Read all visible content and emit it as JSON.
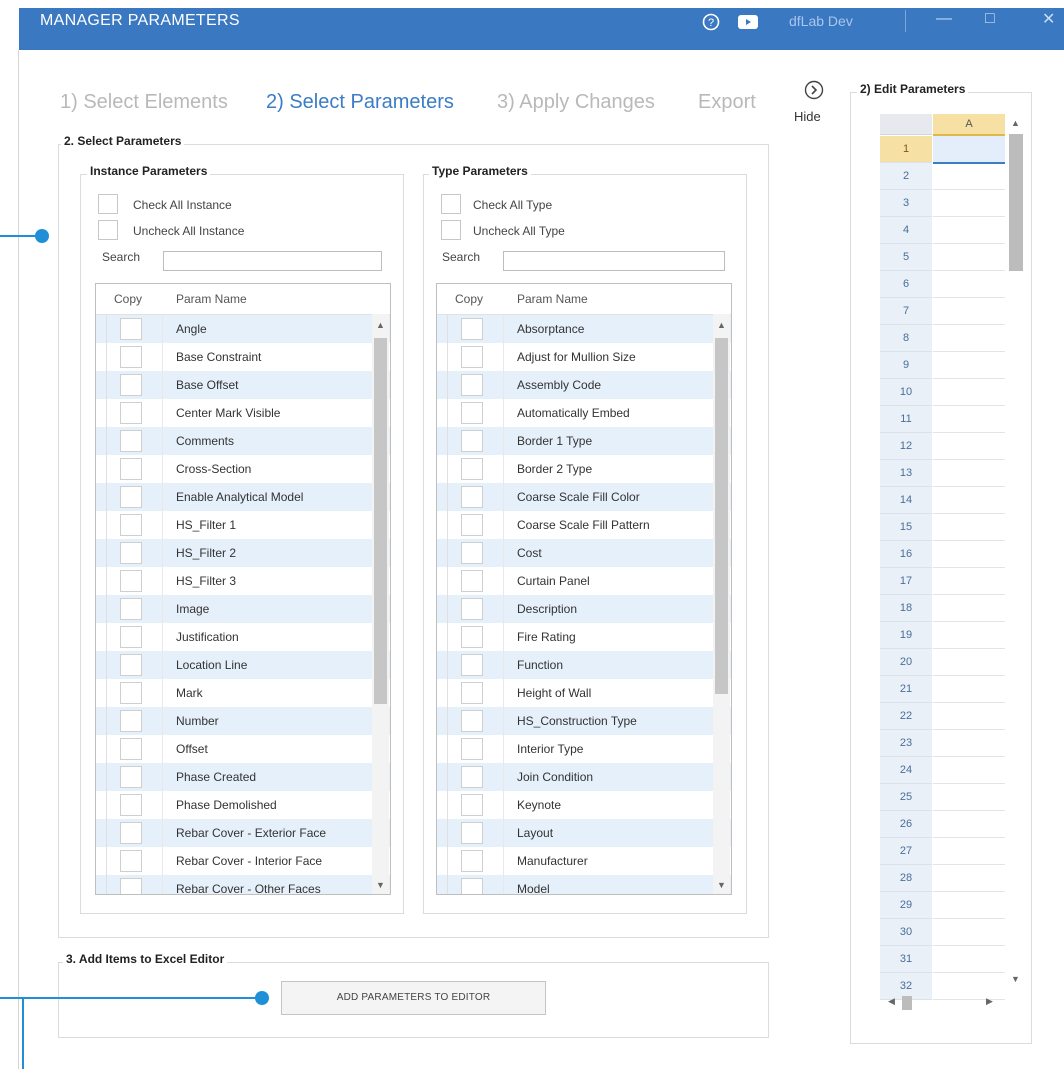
{
  "window": {
    "title": "MANAGER PARAMETERS",
    "user": "dfLab Dev",
    "accent": "#3a78c2"
  },
  "steps": [
    "1) Select Elements",
    "2) Select Parameters",
    "3) Apply Changes",
    "Export"
  ],
  "hide_label": "Hide",
  "select_parameters": {
    "title": "2. Select Parameters",
    "instance": {
      "title": "Instance Parameters",
      "check_all": "Check All Instance",
      "uncheck_all": "Uncheck All Instance",
      "search_label": "Search",
      "search_value": "",
      "columns": [
        "Copy",
        "Param Name"
      ],
      "rows": [
        "Angle",
        "Base Constraint",
        "Base Offset",
        "Center Mark Visible",
        "Comments",
        "Cross-Section",
        "Enable Analytical Model",
        "HS_Filter 1",
        "HS_Filter 2",
        "HS_Filter 3",
        "Image",
        "Justification",
        "Location Line",
        "Mark",
        "Number",
        "Offset",
        "Phase Created",
        "Phase Demolished",
        "Rebar Cover - Exterior Face",
        "Rebar Cover - Interior Face",
        "Rebar Cover - Other Faces"
      ]
    },
    "type": {
      "title": "Type Parameters",
      "check_all": "Check All Type",
      "uncheck_all": "Uncheck All Type",
      "search_label": "Search",
      "search_value": "",
      "columns": [
        "Copy",
        "Param Name"
      ],
      "rows": [
        "Absorptance",
        "Adjust for Mullion Size",
        "Assembly Code",
        "Automatically Embed",
        "Border 1 Type",
        "Border 2 Type",
        "Coarse Scale Fill Color",
        "Coarse Scale Fill Pattern",
        "Cost",
        "Curtain Panel",
        "Description",
        "Fire Rating",
        "Function",
        "Height of Wall",
        "HS_Construction Type",
        "Interior Type",
        "Join Condition",
        "Keynote",
        "Layout",
        "Manufacturer",
        "Model"
      ]
    }
  },
  "add_items": {
    "title": "3. Add Items to Excel Editor",
    "button": "ADD PARAMETERS TO EDITOR"
  },
  "edit_parameters": {
    "title": "2) Edit Parameters",
    "column": "A",
    "rows": [
      "1",
      "2",
      "3",
      "4",
      "5",
      "6",
      "7",
      "8",
      "9",
      "10",
      "11",
      "12",
      "13",
      "14",
      "15",
      "16",
      "17",
      "18",
      "19",
      "20",
      "21",
      "22",
      "23",
      "24",
      "25",
      "26",
      "27",
      "28",
      "29",
      "30",
      "31",
      "32"
    ]
  }
}
